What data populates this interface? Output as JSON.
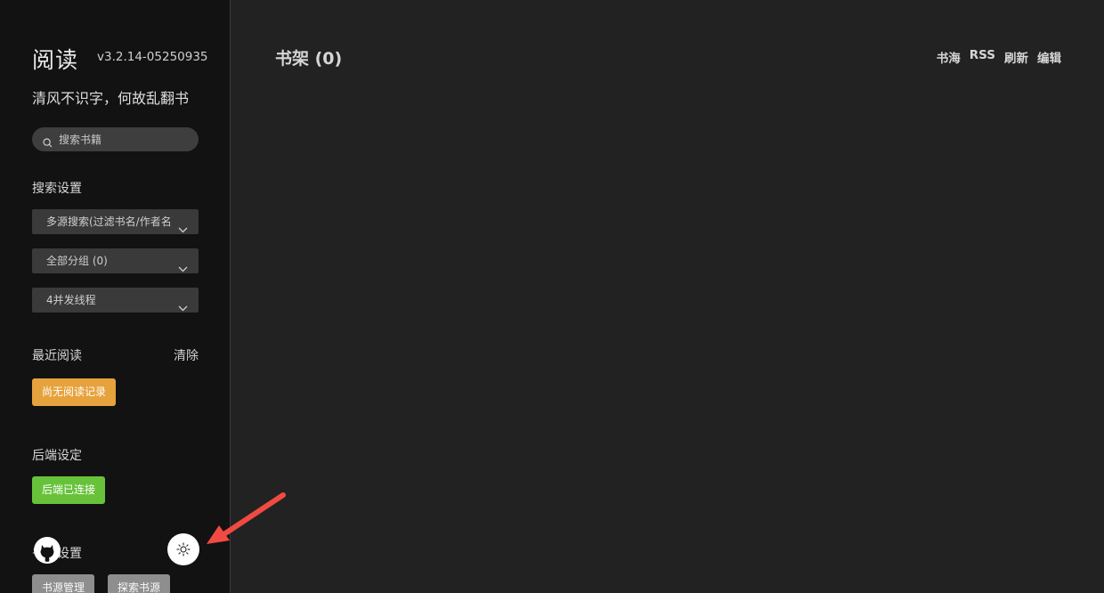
{
  "sidebar": {
    "title": "阅读",
    "version": "v3.2.14-05250935",
    "motto": "清风不识字，何故乱翻书",
    "search": {
      "placeholder": "搜索书籍",
      "value": ""
    },
    "search_settings": {
      "label": "搜索设置",
      "source_mode": "多源搜索(过滤书名/作者名)",
      "group": "全部分组 (0)",
      "threads": "4并发线程"
    },
    "recent": {
      "label": "最近阅读",
      "clear_label": "清除",
      "empty_label": "尚无阅读记录"
    },
    "backend": {
      "label": "后端设定",
      "status_label": "后端已连接"
    },
    "source_settings": {
      "label": "书源设置",
      "manage_label": "书源管理",
      "explore_label": "探索书源"
    }
  },
  "main": {
    "title": "书架 (0)",
    "nav": [
      "书海",
      "RSS",
      "刷新",
      "编辑"
    ]
  },
  "colors": {
    "sidebar_bg": "#121212",
    "main_bg": "#222222",
    "accent_orange": "#e6a23c",
    "accent_green": "#67c23a",
    "annotation_red": "#f04a42"
  }
}
